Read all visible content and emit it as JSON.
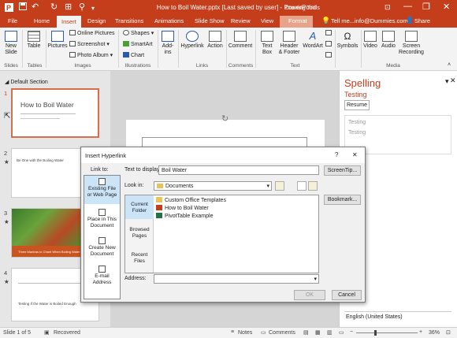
{
  "titlebar": {
    "title": "How to Boil Water.pptx [Last saved by user]  -  PowerPoint",
    "drawing_tools": "Drawing Tools",
    "save_icon": "save-icon",
    "undo_glyph": "↶",
    "redo_glyph": "↻",
    "present_glyph": "⊞",
    "more_glyph": "⚲",
    "dropdown_glyph": "▾",
    "ribbon_display_glyph": "⊡",
    "minimize_glyph": "—",
    "restore_glyph": "❐",
    "close_glyph": "✕"
  },
  "tabs": [
    "File",
    "Home",
    "Insert",
    "Design",
    "Transitions",
    "Animations",
    "Slide Show",
    "Review",
    "View",
    "Format"
  ],
  "tell_me": "Tell me...",
  "account": "info@Dummies.com",
  "share": "Share",
  "ribbon": {
    "new_slide": "New\nSlide",
    "table": "Table",
    "pictures": "Pictures",
    "online_pictures": "Online Pictures",
    "screenshot": "Screenshot",
    "photo_album": "Photo Album",
    "shapes": "Shapes",
    "smartart": "SmartArt",
    "chart": "Chart",
    "addins": "Add-\nins",
    "hyperlink": "Hyperlink",
    "action": "Action",
    "comment": "Comment",
    "text_box": "Text\nBox",
    "header_footer": "Header\n& Footer",
    "wordart": "WordArt",
    "symbols": "Symbols",
    "video": "Video",
    "audio": "Audio",
    "screen_recording": "Screen\nRecording",
    "groups": [
      "Slides",
      "Tables",
      "Images",
      "Illustrations",
      "Links",
      "Comments",
      "Text",
      "Media"
    ]
  },
  "section": "Default Section",
  "slides": [
    {
      "num": "1",
      "title": "How to Boil Water"
    },
    {
      "num": "2",
      "title": "Be One with the Boiling Water"
    },
    {
      "num": "3",
      "title": "Three Mantras to Chant When Boiling Water"
    },
    {
      "num": "4",
      "title": "Testing If the Water is Boiled Enough"
    }
  ],
  "spelling": {
    "header": "Spelling",
    "word": "Testing",
    "resume": "Resume",
    "suggestions": [
      "Testing",
      "Testing"
    ],
    "language": "English (United States)"
  },
  "dialog": {
    "title": "Insert Hyperlink",
    "help": "?",
    "close": "✕",
    "link_to": "Link to:",
    "text_to_display_label": "Text to display:",
    "text_to_display": "Boil Water",
    "screentip": "ScreenTip...",
    "look_in_label": "Look in:",
    "look_in": "Documents",
    "bookmark": "Bookmark...",
    "link_options": [
      "Existing File\nor Web Page",
      "Place in This\nDocument",
      "Create New\nDocument",
      "E-mail\nAddress"
    ],
    "shortcuts": [
      "Current\nFolder",
      "Browsed\nPages",
      "Recent\nFiles"
    ],
    "files": [
      "Custom Office Templates",
      "How to Boil Water",
      "PivotTable Example"
    ],
    "address_label": "Address:",
    "address": "",
    "ok": "OK",
    "cancel": "Cancel"
  },
  "status": {
    "slide": "Slide 1 of 5",
    "recovered": "Recovered",
    "notes": "Notes",
    "comments": "Comments",
    "zoom": "36%"
  },
  "colors": {
    "brand": "#c43e1c",
    "selection": "#d76d4a"
  }
}
